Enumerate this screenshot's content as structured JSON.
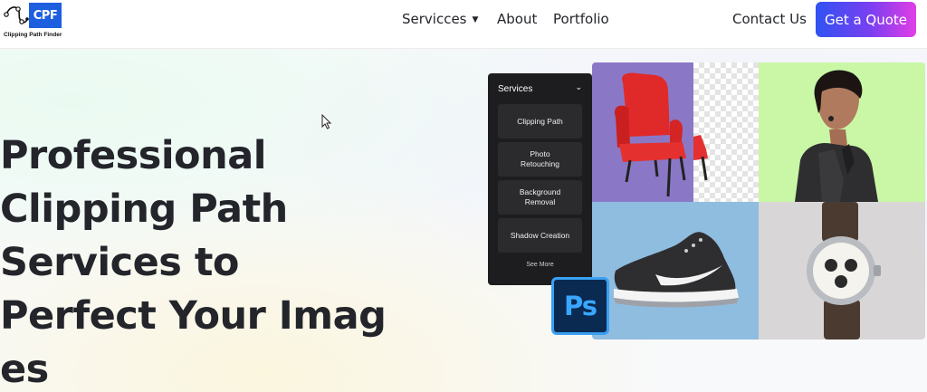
{
  "header": {
    "logo_abbr": "CPF",
    "logo_name": "Clipping Path Finder",
    "nav": {
      "services": "Servicces",
      "about": "About",
      "portfolio": "Portfolio",
      "contact": "Contact Us"
    },
    "cta": "Get a Quote"
  },
  "hero": {
    "headline_lines": [
      "Professional",
      "Clipping Path",
      "Services to",
      "Perfect Your Imag",
      "es"
    ]
  },
  "services_panel": {
    "title": "Services",
    "items": [
      {
        "line1": "Clipping Path",
        "line2": ""
      },
      {
        "line1": "Photo",
        "line2": "Retouching"
      },
      {
        "line1": "Background",
        "line2": "Removal"
      },
      {
        "line1": "Shadow Creation",
        "line2": ""
      }
    ],
    "see_more": "See More"
  },
  "badge": "Ps",
  "colors": {
    "text_dark": "#23252b",
    "cta_gradient_start": "#2f53f2",
    "cta_gradient_end": "#e23ee6",
    "logo_blue": "#1e5fe0",
    "panel_bg": "#1d1d1f"
  },
  "icons": {
    "services_dropdown": "chevron-down-icon",
    "panel_dropdown": "chevron-down-icon",
    "cursor": "mouse-pointer-icon"
  }
}
